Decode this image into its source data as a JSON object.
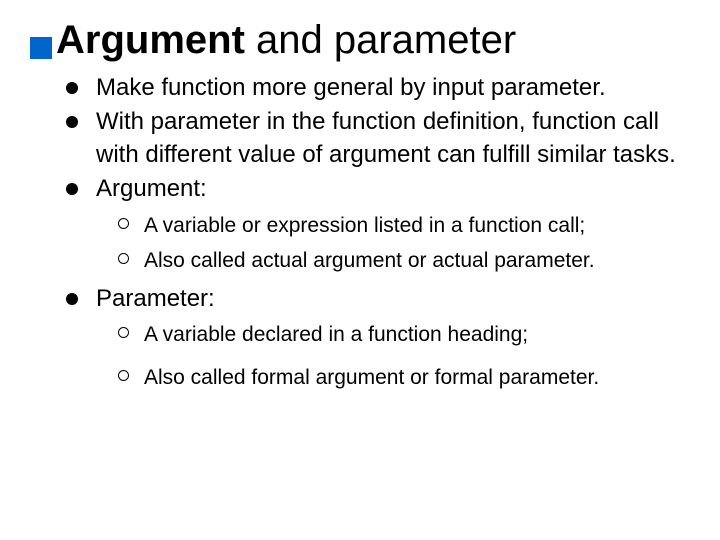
{
  "title": {
    "strong": "Argument",
    "rest": " and parameter"
  },
  "bullets": [
    {
      "text": "Make function more general by input parameter."
    },
    {
      "text": "With parameter in the function definition, function call with different value of argument can fulfill similar tasks."
    },
    {
      "text": "Argument:",
      "sub": [
        "A variable or expression listed in a function call;",
        "Also called actual argument or actual parameter."
      ]
    },
    {
      "text": "Parameter:",
      "sub": [
        "A variable declared in a function heading;",
        "Also called formal argument or formal parameter."
      ]
    }
  ]
}
